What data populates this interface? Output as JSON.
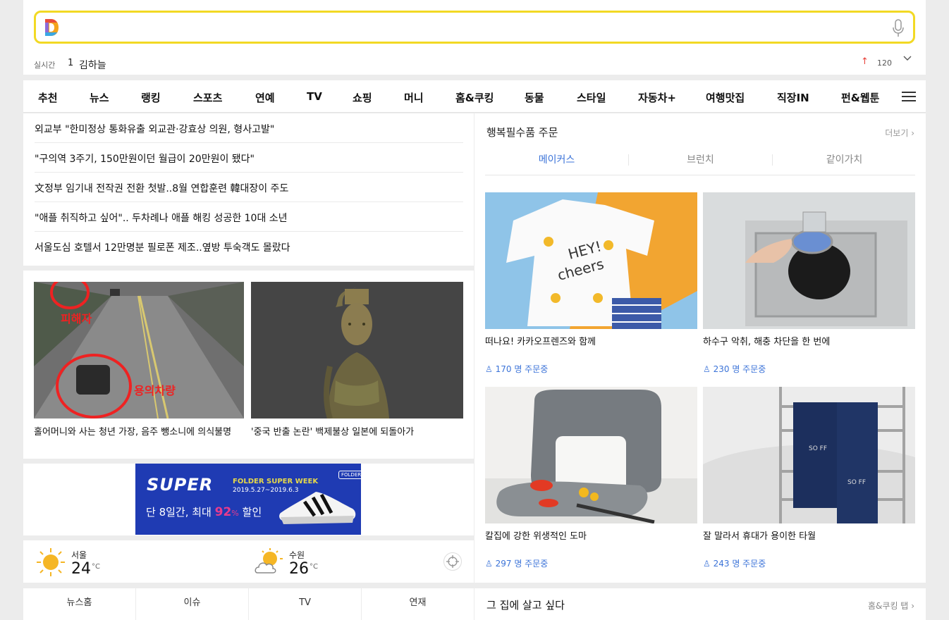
{
  "search": {
    "value": "",
    "placeholder": ""
  },
  "realtime": {
    "label": "실시간",
    "rank": "1",
    "keyword": "김하늘",
    "change_arrow": "↑",
    "change_count": "120"
  },
  "nav": {
    "items": [
      "추천",
      "뉴스",
      "랭킹",
      "스포츠",
      "연예",
      "TV",
      "쇼핑",
      "머니",
      "홈&쿠킹",
      "동물",
      "스타일",
      "자동차+",
      "여행맛집",
      "직장IN",
      "펀&웹툰"
    ]
  },
  "news": {
    "headlines": [
      "외교부 \"한미정상 통화유출 외교관·강효상 의원, 형사고발\"",
      "\"구의역 3주기, 150만원이던 월급이 20만원이 됐다\"",
      "文정부 임기내 전작권 전환 첫발..8월 연합훈련 韓대장이 주도",
      "\"애플 취직하고 싶어\".. 두차례나 애플 해킹 성공한 10대 소년",
      "서울도심 호텔서 12만명분 필로폰 제조..옆방 투숙객도 몰랐다"
    ],
    "photos": [
      {
        "caption": "홀어머니와 사는 청년 가장, 음주 뺑소니에 의식불명",
        "overlay_1": "피해자",
        "overlay_2": "용의차량"
      },
      {
        "caption": "'중국 반출 논란' 백제불상 일본에 되돌아가"
      }
    ]
  },
  "ad": {
    "logo": "SUPER",
    "headline": "FOLDER SUPER WEEK",
    "dates": "2019.5.27~2019.6.3",
    "copy_before": "단 8일간, 최대 ",
    "copy_percent": "92",
    "copy_unit": "%",
    "copy_after": " 할인",
    "brand": "FOLDER"
  },
  "weather": {
    "cities": [
      {
        "name": "서울",
        "temp": "24",
        "unit": "°C",
        "icon": "sun-icon"
      },
      {
        "name": "수원",
        "temp": "26",
        "unit": "°C",
        "icon": "partly-cloudy-icon"
      }
    ]
  },
  "subtabs": [
    "뉴스홈",
    "이슈",
    "TV",
    "연재"
  ],
  "shopping": {
    "title": "행복필수품 주문",
    "more": "더보기",
    "tabs": [
      "메이커스",
      "브런치",
      "같이가치"
    ],
    "active_tab": "메이커스",
    "accent": "#3b73d8",
    "products": [
      {
        "title": "떠나요! 카카오프렌즈와 함께",
        "orders": "170 명 주문중",
        "image_text_1": "HEY!",
        "image_text_2": "cheers"
      },
      {
        "title": "하수구 악취, 해충 차단을 한 번에",
        "orders": "230 명 주문중"
      },
      {
        "title": "칼집에 강한 위생적인 도마",
        "orders": "297 명 주문중"
      },
      {
        "title": "잘 말라서 휴대가 용이한 타월",
        "orders": "243 명 주문중",
        "image_text_1": "SO FF",
        "image_text_2": "SO FF"
      }
    ]
  },
  "house": {
    "title": "그 집에 살고 싶다",
    "more": "홈&쿠킹 탭"
  }
}
